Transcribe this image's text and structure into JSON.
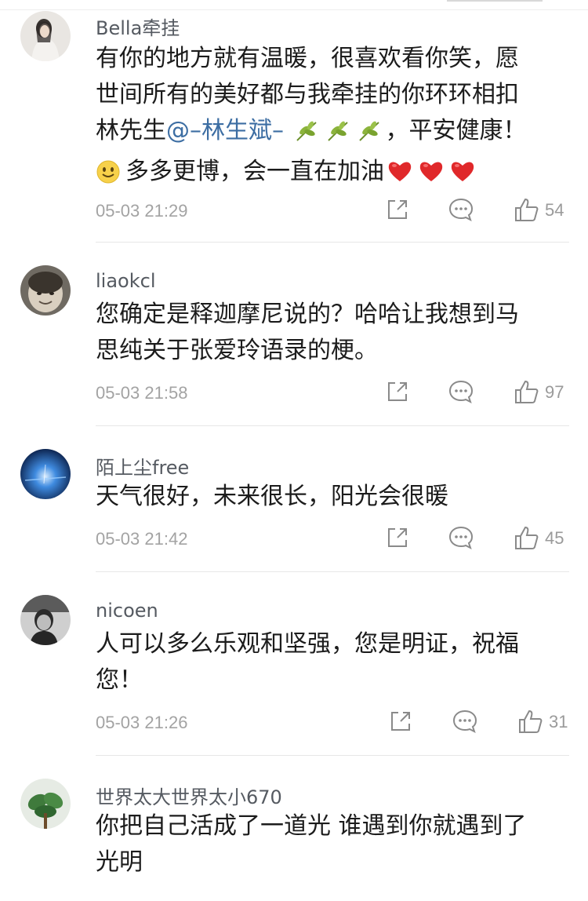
{
  "comments": [
    {
      "username": "Bella牵挂",
      "lines": [
        "有你的地方就有温暖，很喜欢看你笑，愿",
        "世间所有的美好都与我牵挂的你环环相扣"
      ],
      "line3_prefix": "林先生",
      "mention": "@–林生斌–",
      "line3_suffix": "，平安健康！",
      "line4_text": "多多更博，会一直在加油",
      "time": "05-03 21:29",
      "likes": "54"
    },
    {
      "username": "liaokcl",
      "lines": [
        "您确定是释迦摩尼说的？哈哈让我想到马",
        "思纯关于张爱玲语录的梗。"
      ],
      "time": "05-03 21:58",
      "likes": "97"
    },
    {
      "username": "陌上尘free",
      "lines": [
        "天气很好，未来很长，阳光会很暖"
      ],
      "time": "05-03 21:42",
      "likes": "45"
    },
    {
      "username": "nicoen",
      "lines": [
        "人可以多么乐观和坚强，您是明证，祝福",
        "您！"
      ],
      "time": "05-03 21:26",
      "likes": "31"
    },
    {
      "username": "世界太大世界太小670",
      "lines": [
        "你把自己活成了一道光 谁遇到你就遇到了",
        "光明"
      ]
    }
  ],
  "icons": {
    "share": "share-icon",
    "comment": "comment-icon",
    "like": "thumbs-up-icon",
    "leaf": "leaf-emoji-icon",
    "heart": "heart-emoji-icon",
    "smile": "smile-emoji-icon"
  },
  "colors": {
    "mention": "#3d6ea3",
    "text": "#1c1c1c",
    "username": "#555a61",
    "meta": "#a3a3a3",
    "heart": "#e0282a"
  }
}
